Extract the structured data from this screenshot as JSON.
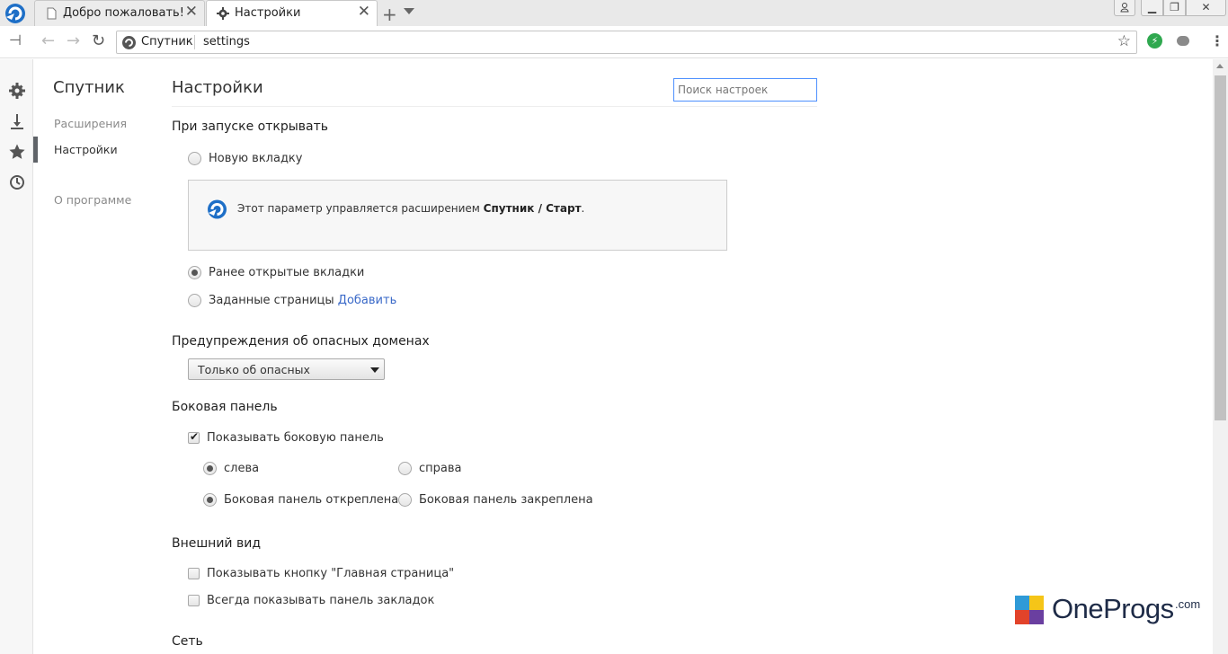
{
  "tabs": [
    {
      "title": "Добро пожаловать!",
      "icon": "page-icon"
    },
    {
      "title": "Настройки",
      "icon": "gear-icon",
      "active": true
    }
  ],
  "window_controls": {
    "user": "person-icon",
    "minimize": "minimize-icon",
    "restore": "restore-icon",
    "close": "close-icon"
  },
  "omnibox": {
    "site": "Спутник",
    "url": "settings"
  },
  "nav": {
    "title": "Спутник",
    "items": [
      "Расширения",
      "Настройки",
      "О программе"
    ],
    "active": "Настройки"
  },
  "main": {
    "title": "Настройки",
    "search_placeholder": "Поиск настроек",
    "startup": {
      "heading": "При запуске открывать",
      "opt_new_tab": "Новую вкладку",
      "notice_prefix": "Этот параметр управляется расширением ",
      "notice_ext": "Спутник / Старт",
      "notice_suffix": ".",
      "opt_previous": "Ранее открытые вкладки",
      "opt_pages": "Заданные страницы",
      "add_link": "Добавить",
      "selected": "opt_previous"
    },
    "dangerous": {
      "heading": "Предупреждения об опасных доменах",
      "selected": "Только об опасных"
    },
    "side_panel": {
      "heading": "Боковая панель",
      "show_label": "Показывать боковую панель",
      "show_checked": true,
      "left": "слева",
      "right": "справа",
      "unpinned": "Боковая панель откреплена",
      "pinned": "Боковая панель закреплена",
      "position_selected": "left",
      "pin_selected": "unpinned"
    },
    "appearance": {
      "heading": "Внешний вид",
      "home_button": "Показывать кнопку \"Главная страница\"",
      "bookmarks_bar": "Всегда показывать панель закладок",
      "home_checked": false,
      "bookmarks_checked": false
    },
    "network": {
      "heading": "Сеть"
    }
  },
  "watermark": {
    "text": "OneProgs",
    "suffix": ".com"
  }
}
